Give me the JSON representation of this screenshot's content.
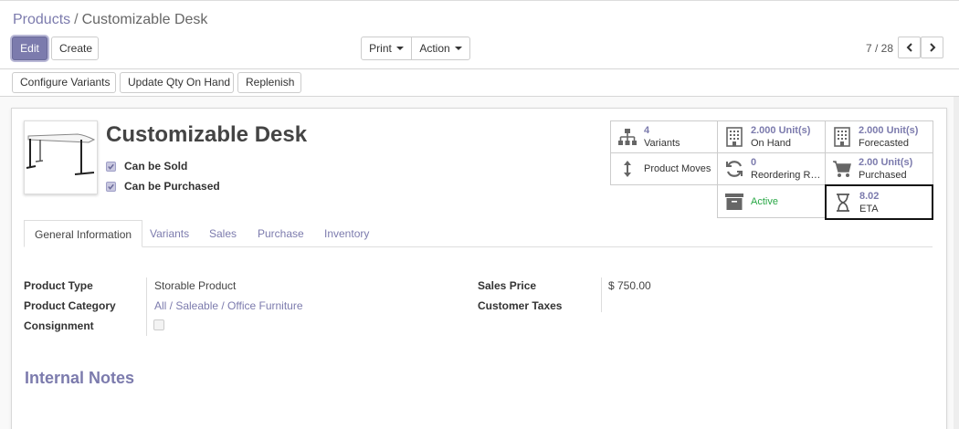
{
  "breadcrumb": {
    "parent": "Products",
    "separator": "/",
    "current": "Customizable Desk"
  },
  "control_panel": {
    "edit_label": "Edit",
    "create_label": "Create",
    "print_label": "Print",
    "action_label": "Action",
    "pager_value": "7 / 28"
  },
  "sub_toolbar": {
    "configure_variants_label": "Configure Variants",
    "update_qty_label": "Update Qty On Hand",
    "replenish_label": "Replenish"
  },
  "product": {
    "name": "Customizable Desk",
    "can_be_sold_label": "Can be Sold",
    "can_be_purchased_label": "Can be Purchased",
    "can_be_sold": true,
    "can_be_purchased": true
  },
  "smart_buttons": {
    "variants": {
      "value": "4",
      "label": "Variants",
      "icon": "sitemap-icon"
    },
    "on_hand": {
      "value": "2.000 Unit(s)",
      "label": "On Hand",
      "icon": "building-icon"
    },
    "forecasted": {
      "value": "2.000 Unit(s)",
      "label": "Forecasted",
      "icon": "building-icon"
    },
    "product_moves": {
      "label": "Product Moves",
      "icon": "arrows-v-icon"
    },
    "reordering": {
      "value": "0",
      "label": "Reordering R…",
      "icon": "refresh-icon"
    },
    "purchased": {
      "value": "2.00 Unit(s)",
      "label": "Purchased",
      "icon": "cart-icon"
    },
    "active": {
      "label": "Active",
      "icon": "archive-icon",
      "color": "#28a745"
    },
    "eta": {
      "value": "8.02",
      "label": "ETA",
      "icon": "hourglass-icon"
    }
  },
  "tabs": [
    {
      "label": "General Information",
      "active": true
    },
    {
      "label": "Variants",
      "active": false
    },
    {
      "label": "Sales",
      "active": false
    },
    {
      "label": "Purchase",
      "active": false
    },
    {
      "label": "Inventory",
      "active": false
    }
  ],
  "general_info": {
    "product_type_label": "Product Type",
    "product_type_value": "Storable Product",
    "product_category_label": "Product Category",
    "product_category_value": "All / Saleable / Office Furniture",
    "consignment_label": "Consignment",
    "consignment_checked": false,
    "sales_price_label": "Sales Price",
    "sales_price_value": "$ 750.00",
    "customer_taxes_label": "Customer Taxes",
    "customer_taxes_value": ""
  },
  "internal_notes_title": "Internal Notes",
  "colors": {
    "primary": "#7c7bad",
    "active_green": "#28a745",
    "text": "#4c4c4c"
  }
}
